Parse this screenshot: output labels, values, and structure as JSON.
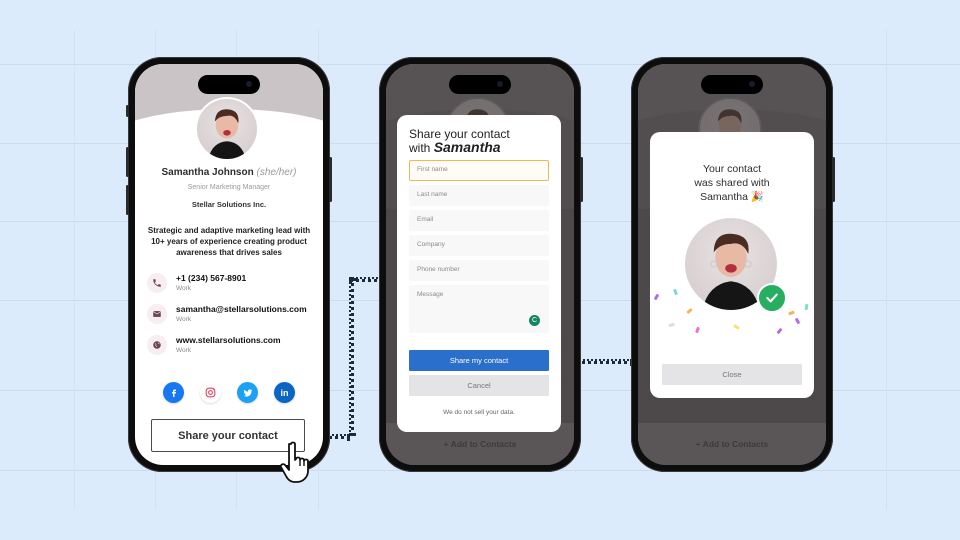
{
  "background_color": "#dcebfc",
  "phone1": {
    "profile": {
      "name": "Samantha Johnson",
      "pronouns": "(she/her)",
      "title": "Senior Marketing Manager",
      "company": "Stellar Solutions Inc.",
      "bio": "Strategic and adaptive marketing lead with 10+ years of experience creating product awareness that drives sales"
    },
    "contacts": [
      {
        "icon": "phone-icon",
        "value": "+1 (234) 567-8901",
        "label": "Work"
      },
      {
        "icon": "email-icon",
        "value": "samantha@stellarsolutions.com",
        "label": "Work"
      },
      {
        "icon": "globe-icon",
        "value": "www.stellarsolutions.com",
        "label": "Work"
      }
    ],
    "social": [
      {
        "name": "facebook",
        "color": "#1877f2"
      },
      {
        "name": "instagram",
        "color": "#e4405f"
      },
      {
        "name": "twitter",
        "color": "#1da1f2"
      },
      {
        "name": "linkedin",
        "color": "#0a66c2"
      }
    ],
    "share_button": "Share your contact"
  },
  "phone2": {
    "modal": {
      "title_line1": "Share your contact",
      "title_with": "with",
      "title_name": "Samantha",
      "fields": [
        {
          "placeholder": "First name",
          "active": true
        },
        {
          "placeholder": "Last name"
        },
        {
          "placeholder": "Email"
        },
        {
          "placeholder": "Company"
        },
        {
          "placeholder": "Phone number"
        },
        {
          "placeholder": "Message"
        }
      ],
      "submit": "Share my contact",
      "cancel": "Cancel",
      "disclaimer": "We do not sell your data."
    },
    "bottom_bar": "+ Add to Contacts"
  },
  "phone3": {
    "modal": {
      "line1": "Your contact",
      "line2": "was shared with",
      "line3": "Samantha 🎉",
      "close": "Close"
    },
    "bottom_bar": "+ Add to Contacts"
  },
  "colors": {
    "primary": "#2a6fcb",
    "success": "#27ae60",
    "active_border": "#e9bb55"
  }
}
